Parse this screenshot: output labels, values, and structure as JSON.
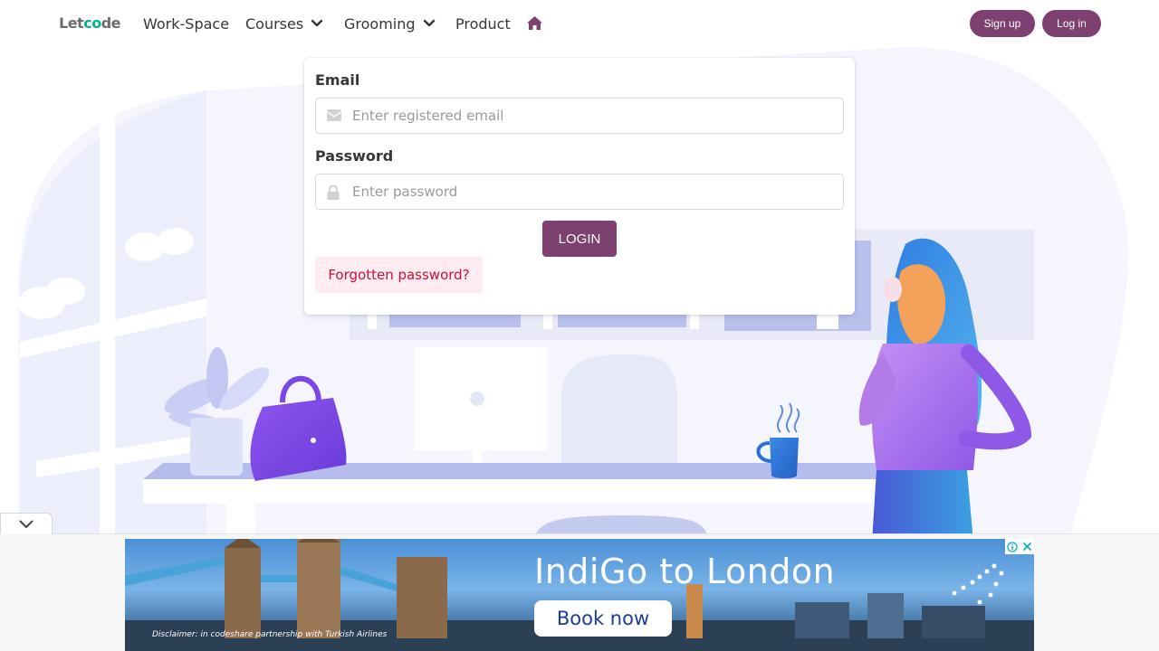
{
  "navbar": {
    "logo_prefix": "Let",
    "logo_accent": "co",
    "logo_suffix": "de",
    "items": [
      {
        "label": "Work-Space"
      },
      {
        "label": "Courses"
      },
      {
        "label": "Grooming"
      },
      {
        "label": "Product"
      }
    ],
    "signup_label": "Sign up",
    "login_label": "Log in"
  },
  "form": {
    "email_label": "Email",
    "email_placeholder": "Enter registered email",
    "email_value": "",
    "password_label": "Password",
    "password_placeholder": "Enter password",
    "password_value": "",
    "login_button": "LOGIN",
    "forgot_link": "Forgotten password?"
  },
  "ad": {
    "headline": "IndiGo to London",
    "cta": "Book now",
    "disclaimer": "Disclaimer: in codeshare partnership with Turkish Airlines"
  },
  "icons": {
    "home": "home-icon",
    "dropdown": "chevron-down-icon",
    "email": "envelope-icon",
    "password": "lock-icon",
    "collapse": "chevron-down-icon",
    "ad_info": "info-icon",
    "ad_close": "close-icon"
  },
  "colors": {
    "primary": "#7e3f71",
    "text": "#363636",
    "danger_bg": "#feecf0",
    "danger_text": "#cc0f35",
    "logo_accent": "#00b58a",
    "illustration_bg": "#eef0fb"
  }
}
